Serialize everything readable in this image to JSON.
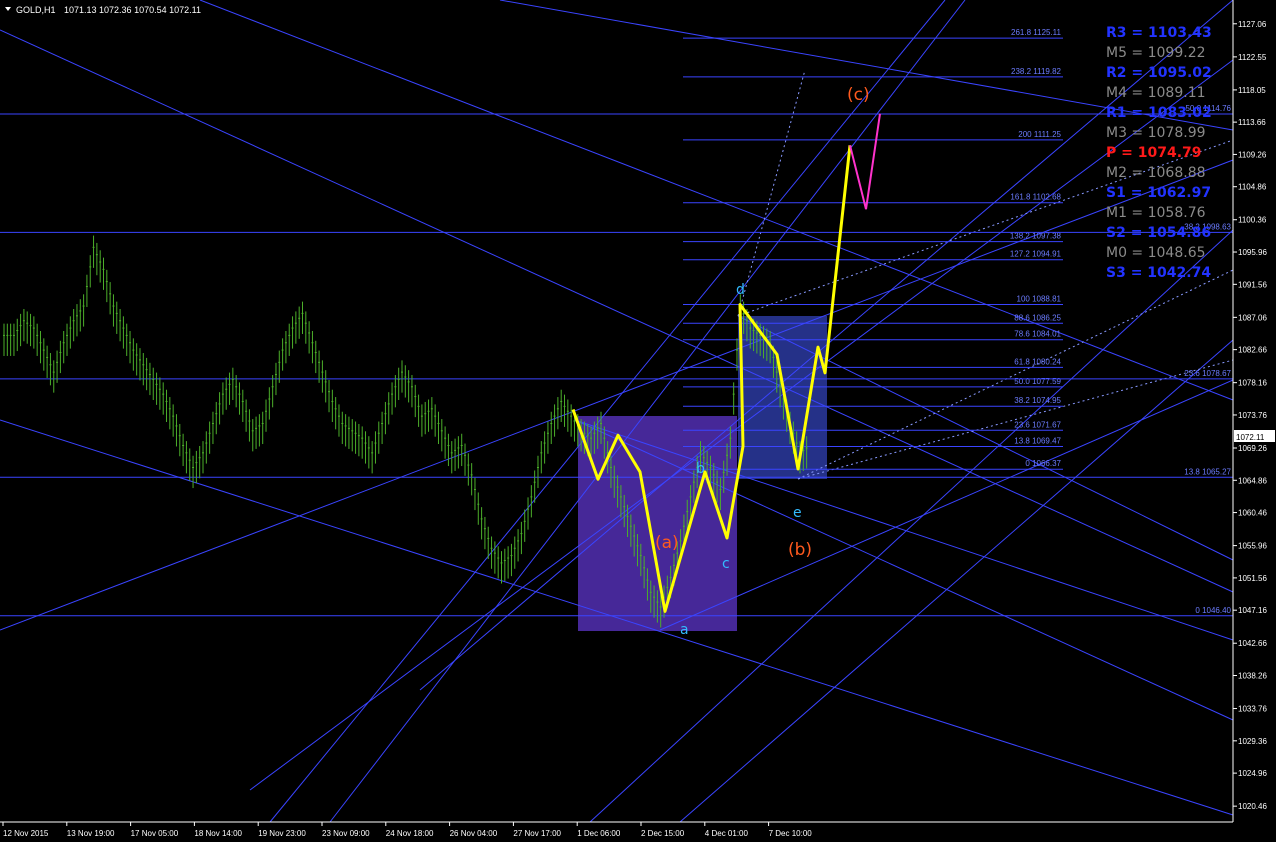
{
  "header": {
    "symbol_label": "GOLD,H1",
    "ohlc": "1071.13 1072.36 1070.54 1072.11"
  },
  "colors": {
    "background": "#000000",
    "candles": "#4caf2a",
    "trendlines": "#3a44ff",
    "fib_text": "#6c7cff",
    "wave_path": "#ffff00",
    "projection": "#ff33cc",
    "label_orange": "#ff5a1e",
    "label_cyan": "#33bbff",
    "pivot_blue": "#2233ff",
    "pivot_gray": "#8a8a8a",
    "pivot_red": "#ff1a1a",
    "box_purple": "#4a2aa0",
    "box_blue": "#27348f"
  },
  "price_scale": {
    "labels": [
      "1127.06",
      "1122.55",
      "1118.05",
      "1113.66",
      "1109.26",
      "1104.86",
      "1100.36",
      "1095.96",
      "1091.56",
      "1087.06",
      "1082.66",
      "1078.16",
      "1073.76",
      "1069.26",
      "1064.86",
      "1060.46",
      "1055.96",
      "1051.56",
      "1047.16",
      "1042.66",
      "1038.26",
      "1033.76",
      "1029.36",
      "1024.96",
      "1020.46"
    ],
    "current_price": "1072.11"
  },
  "time_scale": {
    "labels": [
      "12 Nov 2015",
      "13 Nov 19:00",
      "17 Nov 05:00",
      "18 Nov 14:00",
      "19 Nov 23:00",
      "23 Nov 09:00",
      "24 Nov 18:00",
      "26 Nov 04:00",
      "27 Nov 17:00",
      "1 Dec 06:00",
      "2 Dec 15:00",
      "4 Dec 01:00",
      "7 Dec 10:00"
    ]
  },
  "pivot_levels": [
    {
      "label": "R3 = 1103.43",
      "type": "blue"
    },
    {
      "label": "M5 = 1099.22",
      "type": "gray"
    },
    {
      "label": "R2 = 1095.02",
      "type": "blue"
    },
    {
      "label": "M4 = 1089.11",
      "type": "gray"
    },
    {
      "label": "R1 = 1083.02",
      "type": "blue"
    },
    {
      "label": "M3 = 1078.99",
      "type": "gray"
    },
    {
      "label": "P  = 1074.79",
      "type": "red"
    },
    {
      "label": "M2 = 1068.88",
      "type": "gray"
    },
    {
      "label": "S1 = 1062.97",
      "type": "blue"
    },
    {
      "label": "M1 = 1058.76",
      "type": "gray"
    },
    {
      "label": "S2 = 1054.86",
      "type": "blue"
    },
    {
      "label": "M0 = 1048.65",
      "type": "gray"
    },
    {
      "label": "S3 = 1042.74",
      "type": "blue"
    }
  ],
  "fib_levels_upper": [
    {
      "label": "261.8 1125.11",
      "price": 1125.11
    },
    {
      "label": "238.2 1119.82",
      "price": 1119.82
    },
    {
      "label": "200 1111.25",
      "price": 1111.25
    },
    {
      "label": "161.8 1102.68",
      "price": 1102.68
    },
    {
      "label": "138.2 1097.38",
      "price": 1097.38
    },
    {
      "label": "127.2 1094.91",
      "price": 1094.91
    },
    {
      "label": "100 1088.81",
      "price": 1088.81
    },
    {
      "label": "88.6 1086.25",
      "price": 1086.25
    },
    {
      "label": "78.6 1084.01",
      "price": 1084.01
    },
    {
      "label": "61.8 1080.24",
      "price": 1080.24
    },
    {
      "label": "50.0 1077.59",
      "price": 1077.59
    },
    {
      "label": "38.2 1074.95",
      "price": 1074.95
    },
    {
      "label": "23.6 1071.67",
      "price": 1071.67
    },
    {
      "label": "13.8 1069.47",
      "price": 1069.47
    },
    {
      "label": "0 1066.37",
      "price": 1066.37
    }
  ],
  "fib_levels_right": [
    {
      "label": "50.0 1114.76",
      "price": 1114.76
    },
    {
      "label": "38.2 1098.63",
      "price": 1098.63
    },
    {
      "label": "23.6 1078.67",
      "price": 1078.67
    },
    {
      "label": "13.8 1065.27",
      "price": 1065.27
    },
    {
      "label": "0 1046.40",
      "price": 1046.4
    }
  ],
  "wave_labels": {
    "big_a": "(a)",
    "big_b": "(b)",
    "big_c": "(c)",
    "a": "a",
    "b": "b",
    "c": "c",
    "d": "d",
    "e": "e"
  },
  "chart_data": {
    "type": "candlestick",
    "symbol": "GOLD",
    "timeframe": "H1",
    "ylim": [
      1018.3,
      1130.3
    ],
    "x_labels": [
      "12 Nov 2015",
      "13 Nov 19:00",
      "17 Nov 05:00",
      "18 Nov 14:00",
      "19 Nov 23:00",
      "23 Nov 09:00",
      "24 Nov 18:00",
      "26 Nov 04:00",
      "27 Nov 17:00",
      "1 Dec 06:00",
      "2 Dec 15:00",
      "4 Dec 01:00",
      "7 Dec 10:00"
    ],
    "series": [
      {
        "values": [
          1084,
          1086,
          1085,
          1082,
          1079,
          1083,
          1086,
          1088,
          1096,
          1093,
          1088,
          1085,
          1082,
          1080,
          1078,
          1076,
          1073,
          1069,
          1066,
          1068,
          1072,
          1076,
          1078,
          1075,
          1071,
          1072,
          1077,
          1082,
          1085,
          1087,
          1083,
          1079,
          1075,
          1072,
          1071,
          1070,
          1068,
          1072,
          1076,
          1079,
          1077,
          1073,
          1074,
          1071,
          1068,
          1069,
          1065,
          1059,
          1055,
          1053,
          1054,
          1057,
          1062,
          1068,
          1072,
          1075,
          1073,
          1071,
          1070,
          1072,
          1066,
          1062,
          1058,
          1054,
          1049,
          1047,
          1051,
          1056,
          1062,
          1068,
          1066,
          1063,
          1070,
          1088,
          1085,
          1084,
          1083,
          1077,
          1072,
          1068,
          1069
        ]
      }
    ],
    "wave_path_prices": [
      1074.5,
      1065,
      1071,
      1066,
      1047,
      1066,
      1057,
      1069.5,
      1088.8,
      1082,
      1066.4,
      1083,
      1079.5,
      1110.5
    ],
    "projection_prices": [
      1110.5,
      1101.8,
      1114.8
    ]
  }
}
